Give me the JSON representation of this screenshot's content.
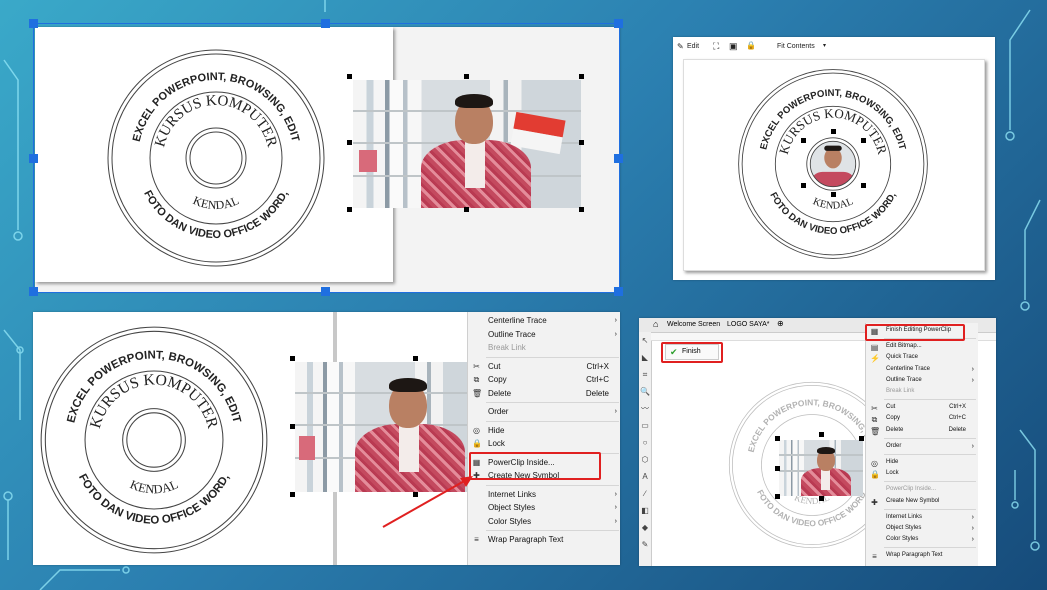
{
  "logo": {
    "top_arc": "EXCEL POWERPOINT, BROWSING, EDIT",
    "bottom_arc": "FOTO DAN VIDEO  OFFICE WORD,",
    "inner_top": "KURSUS KOMPUTER",
    "inner_bottom": "KENDAL"
  },
  "panel_tr": {
    "edit": "Edit",
    "fit_contents": "Fit Contents"
  },
  "menu_bl": {
    "items": [
      {
        "icon": "",
        "label": "Centerline Trace",
        "shortcut": "",
        "arrow": "›",
        "disabled": false
      },
      {
        "icon": "",
        "label": "Outline Trace",
        "shortcut": "",
        "arrow": "›",
        "disabled": false
      },
      {
        "icon": "",
        "label": "Break Link",
        "shortcut": "",
        "arrow": "",
        "disabled": true
      },
      {
        "icon": "✂",
        "label": "Cut",
        "shortcut": "Ctrl+X",
        "arrow": "",
        "disabled": false
      },
      {
        "icon": "⧉",
        "label": "Copy",
        "shortcut": "Ctrl+C",
        "arrow": "",
        "disabled": false
      },
      {
        "icon": "🗑",
        "label": "Delete",
        "shortcut": "Delete",
        "arrow": "",
        "disabled": false
      },
      {
        "icon": "",
        "label": "Order",
        "shortcut": "",
        "arrow": "›",
        "disabled": false
      },
      {
        "icon": "◎",
        "label": "Hide",
        "shortcut": "",
        "arrow": "",
        "disabled": false
      },
      {
        "icon": "🔒",
        "label": "Lock",
        "shortcut": "",
        "arrow": "",
        "disabled": false
      },
      {
        "icon": "▦",
        "label": "PowerClip Inside...",
        "shortcut": "",
        "arrow": "",
        "disabled": false
      },
      {
        "icon": "✚",
        "label": "Create New Symbol",
        "shortcut": "",
        "arrow": "",
        "disabled": false
      },
      {
        "icon": "",
        "label": "Internet Links",
        "shortcut": "",
        "arrow": "›",
        "disabled": false
      },
      {
        "icon": "",
        "label": "Object Styles",
        "shortcut": "",
        "arrow": "›",
        "disabled": false
      },
      {
        "icon": "",
        "label": "Color Styles",
        "shortcut": "",
        "arrow": "›",
        "disabled": false
      },
      {
        "icon": "≡",
        "label": "Wrap Paragraph Text",
        "shortcut": "",
        "arrow": "",
        "disabled": false
      }
    ]
  },
  "panel_br": {
    "tab_welcome": "Welcome Screen",
    "tab_doc": "LOGO SAYA*",
    "finish": "Finish",
    "menu_items": [
      {
        "icon": "▦",
        "label": "Finish Editing PowerClip",
        "shortcut": "",
        "arrow": "",
        "disabled": false
      },
      {
        "icon": "▤",
        "label": "Edit Bitmap...",
        "shortcut": "",
        "arrow": "",
        "disabled": false
      },
      {
        "icon": "⚡",
        "label": "Quick Trace",
        "shortcut": "",
        "arrow": "",
        "disabled": false
      },
      {
        "icon": "",
        "label": "Centerline Trace",
        "shortcut": "",
        "arrow": "›",
        "disabled": false
      },
      {
        "icon": "",
        "label": "Outline Trace",
        "shortcut": "",
        "arrow": "›",
        "disabled": false
      },
      {
        "icon": "",
        "label": "Break Link",
        "shortcut": "",
        "arrow": "",
        "disabled": true
      },
      {
        "icon": "✂",
        "label": "Cut",
        "shortcut": "Ctrl+X",
        "arrow": "",
        "disabled": false
      },
      {
        "icon": "⧉",
        "label": "Copy",
        "shortcut": "Ctrl+C",
        "arrow": "",
        "disabled": false
      },
      {
        "icon": "🗑",
        "label": "Delete",
        "shortcut": "Delete",
        "arrow": "",
        "disabled": false
      },
      {
        "icon": "",
        "label": "Order",
        "shortcut": "",
        "arrow": "›",
        "disabled": false
      },
      {
        "icon": "◎",
        "label": "Hide",
        "shortcut": "",
        "arrow": "",
        "disabled": false
      },
      {
        "icon": "🔒",
        "label": "Lock",
        "shortcut": "",
        "arrow": "",
        "disabled": false
      },
      {
        "icon": "",
        "label": "PowerClip Inside...",
        "shortcut": "",
        "arrow": "",
        "disabled": true
      },
      {
        "icon": "✚",
        "label": "Create New Symbol",
        "shortcut": "",
        "arrow": "",
        "disabled": false
      },
      {
        "icon": "",
        "label": "Internet Links",
        "shortcut": "",
        "arrow": "›",
        "disabled": false
      },
      {
        "icon": "",
        "label": "Object Styles",
        "shortcut": "",
        "arrow": "›",
        "disabled": false
      },
      {
        "icon": "",
        "label": "Color Styles",
        "shortcut": "",
        "arrow": "›",
        "disabled": false
      },
      {
        "icon": "≡",
        "label": "Wrap Paragraph Text",
        "shortcut": "",
        "arrow": "",
        "disabled": false
      }
    ]
  },
  "colors": {
    "highlight_red": "#e02020",
    "selection_blue": "#1f6fe0"
  }
}
